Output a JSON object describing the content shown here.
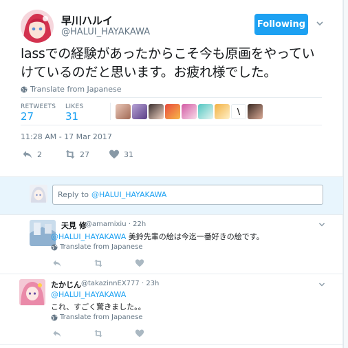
{
  "tweet": {
    "author_name": "早川ハルイ",
    "author_handle": "@HALUI_HAYAKAWA",
    "follow_button": "Following",
    "text": "lassでの経験があったからこそ今も原画をやっていけているのだと思います。お疲れ様でした。",
    "translate_label": "Translate from Japanese",
    "retweets_label": "RETWEETS",
    "retweets_count": "27",
    "likes_label": "LIKES",
    "likes_count": "31",
    "timestamp": "11:28 AM - 17 Mar 2017",
    "reply_count": "2",
    "retweet_count": "27",
    "like_count": "31"
  },
  "reply_box": {
    "prefix": "Reply to",
    "mention": "@HALUI_HAYAKAWA"
  },
  "replies": [
    {
      "name": "天見 修",
      "handle": "@amamixiu",
      "time": "22h",
      "mention": "@HALUI_HAYAKAWA",
      "text_line1": "美鈴先輩の絵は今迄一番好きの絵です。",
      "text_line2": "",
      "translate_label": "Translate from Japanese"
    },
    {
      "name": "たかじん",
      "handle": "@takazinnEX777",
      "time": "23h",
      "mention": "@HALUI_HAYAKAWA",
      "text_line1": "",
      "text_line2": "これ、すごく驚きました。。",
      "translate_label": "Translate from Japanese"
    }
  ],
  "colors": {
    "accent": "#1da1f2",
    "muted": "#657786",
    "reply_bg": "#e8f5fd"
  }
}
